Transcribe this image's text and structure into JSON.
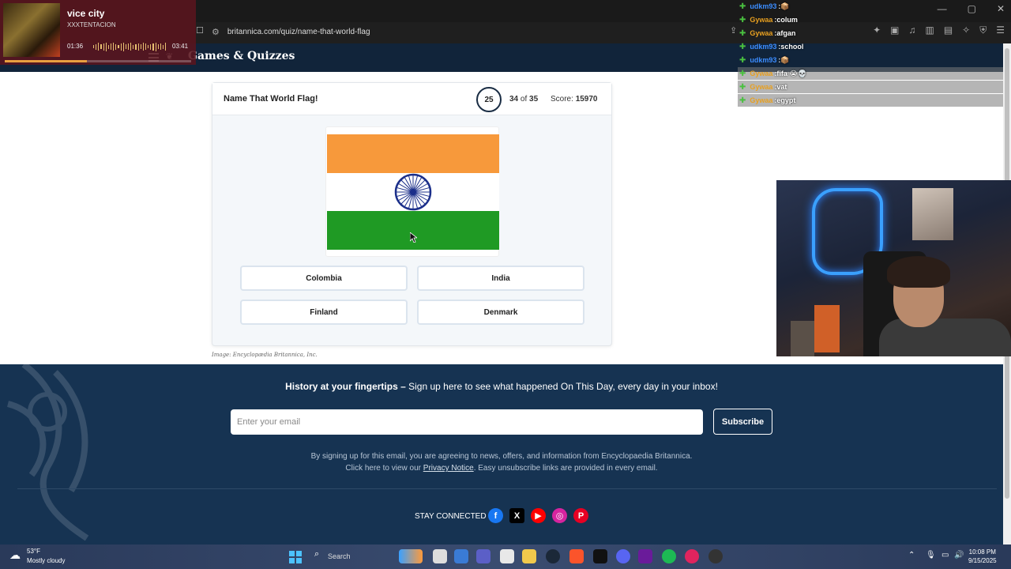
{
  "music": {
    "track": "vice city",
    "artist": "XXXTENTACION",
    "current_time": "01:36",
    "total_time": "03:41",
    "progress": 0.44
  },
  "browser": {
    "url": "britannica.com/quiz/name-that-world-flag"
  },
  "site": {
    "title": "Games & Quizzes"
  },
  "quiz": {
    "title": "Name That World Flag!",
    "timer": "25",
    "progress_current": "34",
    "progress_of": "of",
    "progress_total": "35",
    "score_label": "Score:",
    "score_value": "15970",
    "flag_colors": {
      "top": "#f7993b",
      "middle": "#ffffff",
      "bottom": "#1f9a24",
      "wheel": "#1b2f8a"
    },
    "answers": [
      "Colombia",
      "India",
      "Finland",
      "Denmark"
    ],
    "caption": "Image: Encyclopædia Britannica, Inc."
  },
  "footer": {
    "promo_bold": "History at your fingertips –",
    "promo_text": " Sign up here to see what happened On This Day, every day in your inbox!",
    "email_placeholder": "Enter your email",
    "subscribe_label": "Subscribe",
    "legal_line1": "By signing up for this email, you are agreeing to news, offers, and information from Encyclopaedia Britannica.",
    "legal_line2_pre": "Click here to view our ",
    "legal_link": "Privacy Notice",
    "legal_line2_post": ". Easy unsubscribe links are provided in every email.",
    "stay_connected": "STAY CONNECTED",
    "social": [
      {
        "name": "facebook-icon",
        "glyph": "f",
        "color": "#1877f2"
      },
      {
        "name": "x-icon",
        "glyph": "X",
        "color": "#000000"
      },
      {
        "name": "youtube-icon",
        "glyph": "▶",
        "color": "#ff0000"
      },
      {
        "name": "instagram-icon",
        "glyph": "◎",
        "color": "#d6249f"
      },
      {
        "name": "pinterest-icon",
        "glyph": "P",
        "color": "#e60023"
      }
    ]
  },
  "chat": [
    {
      "user": "udkm93",
      "user_color": "#3b8cff",
      "msg": "📦",
      "dim": false
    },
    {
      "user": "Gywaa",
      "user_color": "#e8a020",
      "msg": "colum",
      "dim": false
    },
    {
      "user": "Gywaa",
      "user_color": "#e8a020",
      "msg": "afgan",
      "dim": false
    },
    {
      "user": "udkm93",
      "user_color": "#3b8cff",
      "msg": "school",
      "dim": false
    },
    {
      "user": "udkm93",
      "user_color": "#3b8cff",
      "msg": "📦",
      "dim": false
    },
    {
      "user": "Gywaa",
      "user_color": "#e8a020",
      "msg": "fifa 😭💀",
      "dim": true
    },
    {
      "user": "Gywaa",
      "user_color": "#e8a020",
      "msg": "vat",
      "dim": true
    },
    {
      "user": "Gywaa",
      "user_color": "#e8a020",
      "msg": "egypt",
      "dim": true
    }
  ],
  "taskbar": {
    "weather_temp": "53°F",
    "weather_desc": "Mostly cloudy",
    "search_label": "Search",
    "time": "10:08 PM",
    "date": "9/15/2025"
  }
}
